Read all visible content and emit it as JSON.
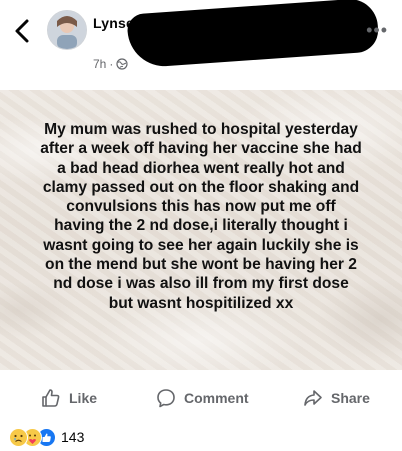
{
  "header": {
    "name": "Lynsey",
    "time": "7h",
    "privacy_icon": "globe-icon",
    "more_icon": "more-horizontal-icon",
    "more_label": "•••"
  },
  "post": {
    "text": "My mum was rushed to hospital yesterday after a week off having her vaccine she had a bad head diorhea went really hot and clamy passed out on the floor shaking and convulsions this has now put me off having the 2 nd dose,i literally thought i wasnt  going to see her again luckily she is on the mend but she wont be having her 2 nd dose i was also ill from my first dose but wasnt hospitilized xx"
  },
  "actions": {
    "like_label": "Like",
    "comment_label": "Comment",
    "share_label": "Share"
  },
  "reactions": {
    "icons": [
      "sad-icon",
      "care-icon",
      "like-icon"
    ],
    "count": "143"
  },
  "colors": {
    "meta_gray": "#65676b",
    "like_blue": "#1877f2",
    "emoji_yellow": "#f7c948"
  }
}
